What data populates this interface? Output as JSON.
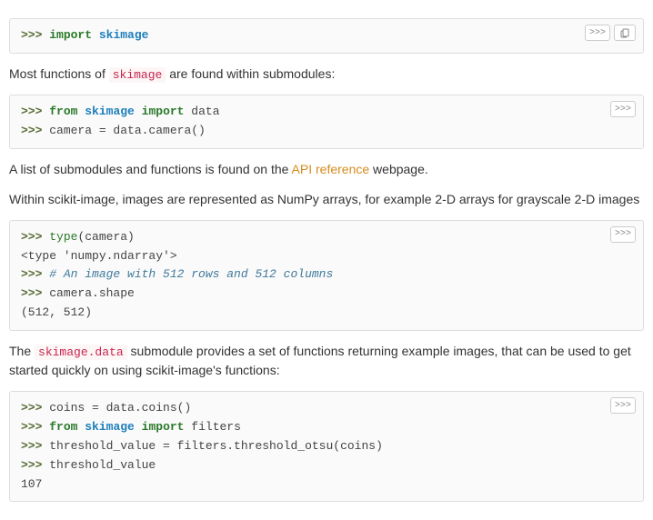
{
  "buttons": {
    "prompt_toggle": ">>>"
  },
  "block1": {
    "l1": {
      "prompt": ">>>",
      "kw": "import",
      "mod": "skimage"
    }
  },
  "para1": {
    "pre": "Most functions of ",
    "code": "skimage",
    "post": " are found within submodules:"
  },
  "block2": {
    "l1": {
      "prompt": ">>>",
      "kw1": "from",
      "mod": "skimage",
      "kw2": "import",
      "name": "data"
    },
    "l2": {
      "prompt": ">>>",
      "code": "camera = data.camera()"
    }
  },
  "para2": {
    "pre": "A list of submodules and functions is found on the ",
    "link": "API reference",
    "post": " webpage."
  },
  "para3": {
    "text": "Within scikit-image, images are represented as NumPy arrays, for example 2-D arrays for grayscale 2-D images"
  },
  "block3": {
    "l1": {
      "prompt": ">>>",
      "builtin": "type",
      "rest": "(camera)"
    },
    "l2": {
      "out": "<type 'numpy.ndarray'>"
    },
    "l3": {
      "prompt": ">>>",
      "comment": "# An image with 512 rows and 512 columns"
    },
    "l4": {
      "prompt": ">>>",
      "code": "camera.shape"
    },
    "l5": {
      "out": "(512, 512)"
    }
  },
  "para4": {
    "pre": "The ",
    "code": "skimage.data",
    "post": " submodule provides a set of functions returning example images, that can be used to get started quickly on using scikit-image's functions:"
  },
  "block4": {
    "l1": {
      "prompt": ">>>",
      "code": "coins = data.coins()"
    },
    "l2": {
      "prompt": ">>>",
      "kw1": "from",
      "mod": "skimage",
      "kw2": "import",
      "name": "filters"
    },
    "l3": {
      "prompt": ">>>",
      "code": "threshold_value = filters.threshold_otsu(coins)"
    },
    "l4": {
      "prompt": ">>>",
      "code": "threshold_value"
    },
    "l5": {
      "out": "107"
    }
  }
}
